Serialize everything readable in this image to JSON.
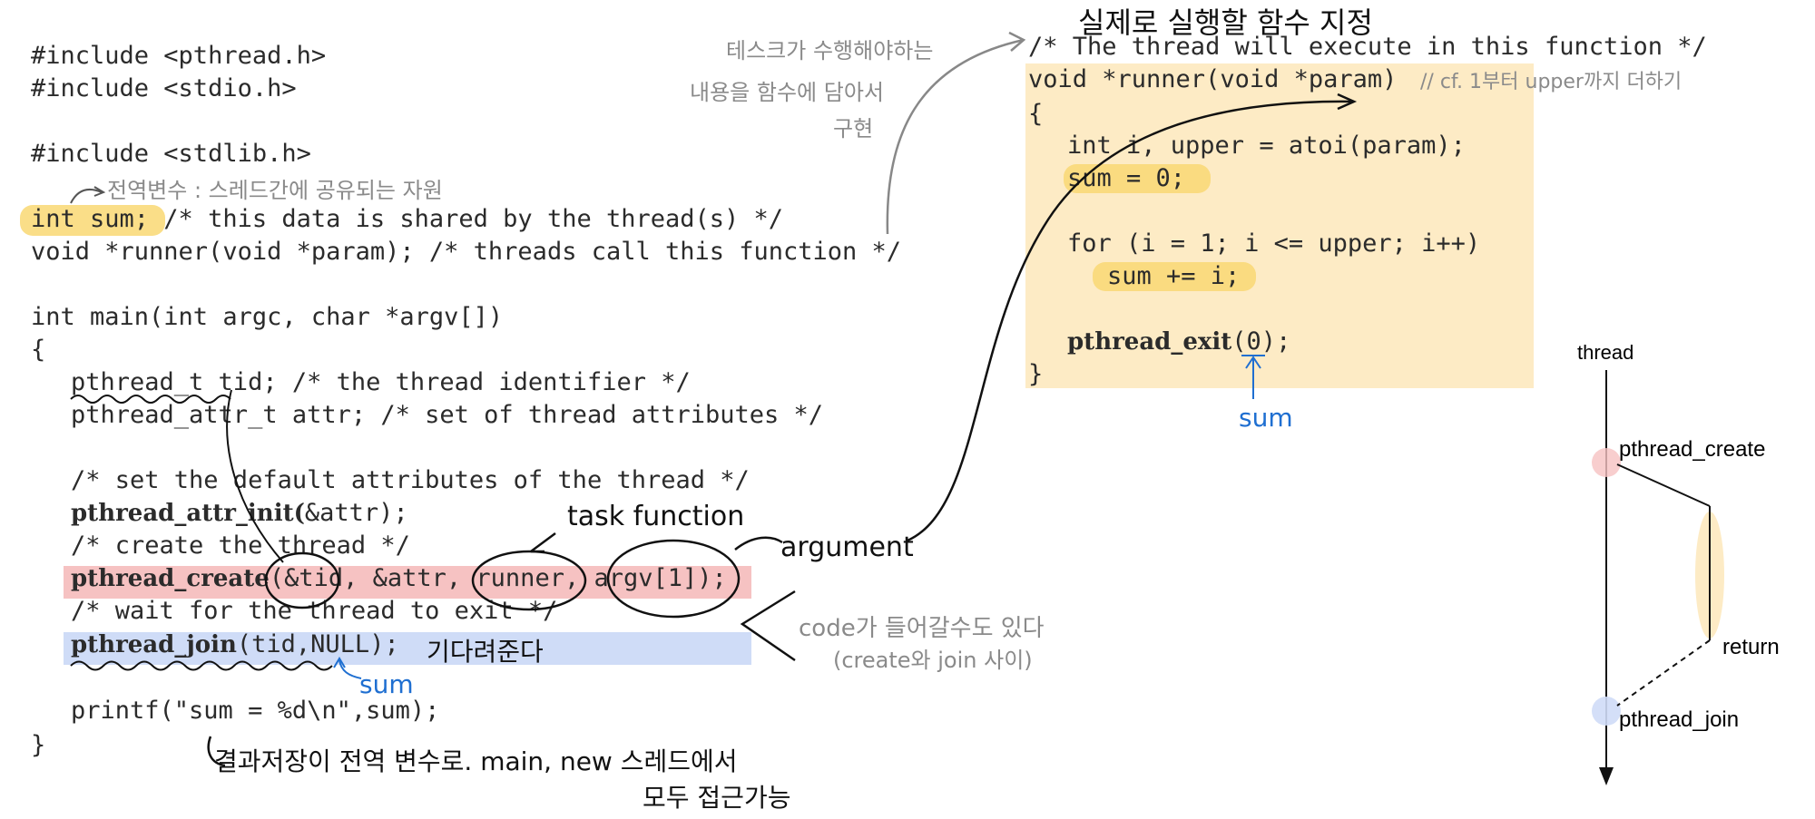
{
  "code_left": {
    "lines": [
      "#include <pthread.h>",
      "#include <stdio.h>",
      "#include <stdlib.h>",
      "int sum; /* this data is shared by the thread(s) */",
      "void *runner(void *param); /* threads call this function */",
      "int main(int argc, char *argv[])",
      "{",
      "pthread_t tid; /* the thread identifier */",
      "pthread_attr_t attr; /* set of thread attributes */",
      "/* set the default attributes of the thread */",
      "&attr);",
      "/* create the thread */",
      "(&tid, &attr, runner, argv[1]);",
      "/* wait for the thread to exit */",
      "(tid,NULL);",
      "printf(\"sum = %d\\n\",sum);",
      "}"
    ],
    "bold_tokens": {
      "attr_init": "pthread_attr_init(",
      "create": "pthread_create",
      "join": "pthread_join"
    }
  },
  "code_right": {
    "lines": [
      "/* The thread will execute in this function */",
      "void *runner(void *param)",
      "{",
      "int i, upper = atoi(param);",
      "sum = 0;",
      "for (i = 1; i <= upper; i++)",
      "sum += i;",
      "(0);",
      "}"
    ],
    "bold_exit": "pthread_exit"
  },
  "annotations": {
    "shared_global": "전역변수 : 스레드간에 공유되는 자원",
    "task_desc_1": "테스크가 수행해야하는",
    "task_desc_2": "내용을  함수에 담아서",
    "task_desc_3": "구현",
    "runner_title": "실제로 실행할 함수 지정",
    "param_note": "// cf. 1부터 upper까지 더하기",
    "task_function": "task function",
    "argument": "argument",
    "wait": "기다려준다",
    "sum_join": "sum",
    "sum_exit": "sum",
    "code_note_1": "code가 들어갈수도 있다",
    "code_note_2": "(create와 join 사이)",
    "result_1": "결과저장이  전역 변수로. main, new 스레드에서",
    "result_2": "모두 접근가능"
  },
  "diagram": {
    "thread": "thread",
    "create": "pthread_create",
    "return": "return",
    "join": "pthread_join"
  },
  "colors": {
    "highlight_yellow": "#f9d873",
    "highlight_red": "#f6c2c2",
    "highlight_blue": "#cfdcf7",
    "panel": "#fdebc5",
    "ink_blue": "#1f6fd1"
  }
}
